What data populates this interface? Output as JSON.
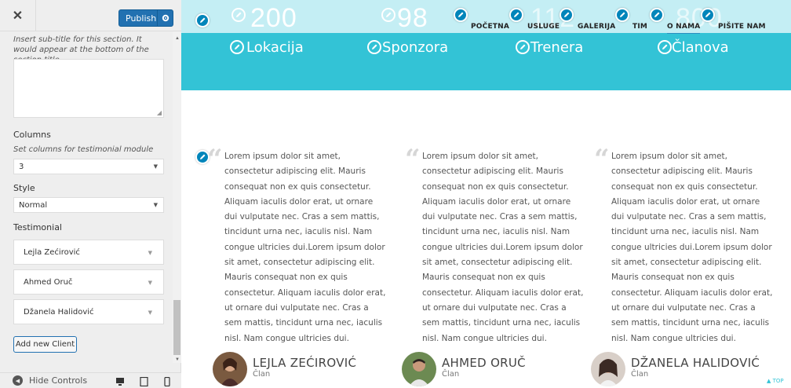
{
  "sidebar": {
    "close_label": "✕",
    "publish_label": "Publish",
    "subtitle_desc": "Insert sub-title for this section. It would appear at the bottom of the section title.",
    "subtitle_value": "",
    "columns_label": "Columns",
    "columns_desc": "Set columns for testimonial module",
    "columns_value": "3",
    "style_label": "Style",
    "style_value": "Normal",
    "testimonial_label": "Testimonial",
    "testimonials": [
      "Lejla Zećirović",
      "Ahmed Oruč",
      "Džanela Halidović"
    ],
    "add_client_label": "Add new Client",
    "hide_controls_label": "Hide Controls"
  },
  "preview": {
    "stats": [
      {
        "number": "200",
        "label": "Lokacija"
      },
      {
        "number": "98",
        "label": "Sponzora"
      },
      {
        "number": "112",
        "label": "Trenera"
      },
      {
        "number": "800",
        "label": "Članova"
      }
    ],
    "nav": [
      "POČETNA",
      "USLUGE",
      "GALERIJA",
      "TIM",
      "O NAMA",
      "PIŠITE NAM"
    ],
    "active_nav": "O NAMA",
    "testimonials": [
      {
        "text": "Lorem ipsum dolor sit amet, consectetur adipiscing elit. Mauris consequat non ex quis consectetur. Aliquam iaculis dolor erat, ut ornare dui vulputate nec. Cras a sem mattis, tincidunt urna nec, iaculis nisl. Nam congue ultricies dui.Lorem ipsum dolor sit amet, consectetur adipiscing elit. Mauris consequat non ex quis consectetur. Aliquam iaculis dolor erat, ut ornare dui vulputate nec. Cras a sem mattis, tincidunt urna nec, iaculis nisl. Nam congue ultricies dui.",
        "name": "LEJLA ZEĆIROVIĆ",
        "role": "Član"
      },
      {
        "text": "Lorem ipsum dolor sit amet, consectetur adipiscing elit. Mauris consequat non ex quis consectetur. Aliquam iaculis dolor erat, ut ornare dui vulputate nec. Cras a sem mattis, tincidunt urna nec, iaculis nisl. Nam congue ultricies dui.Lorem ipsum dolor sit amet, consectetur adipiscing elit. Mauris consequat non ex quis consectetur. Aliquam iaculis dolor erat, ut ornare dui vulputate nec. Cras a sem mattis, tincidunt urna nec, iaculis nisl. Nam congue ultricies dui.",
        "name": "AHMED ORUČ",
        "role": "Član"
      },
      {
        "text": "Lorem ipsum dolor sit amet, consectetur adipiscing elit. Mauris consequat non ex quis consectetur. Aliquam iaculis dolor erat, ut ornare dui vulputate nec. Cras a sem mattis, tincidunt urna nec, iaculis nisl. Nam congue ultricies dui.Lorem ipsum dolor sit amet, consectetur adipiscing elit. Mauris consequat non ex quis consectetur. Aliquam iaculis dolor erat, ut ornare dui vulputate nec. Cras a sem mattis, tincidunt urna nec, iaculis nisl. Nam congue ultricies dui.",
        "name": "DŽANELA HALIDOVIĆ",
        "role": "Član"
      }
    ],
    "top_link": "▲ TOP"
  },
  "colors": {
    "accent": "#33c3d6",
    "publish": "#2271b1",
    "edit": "#0085ba"
  }
}
